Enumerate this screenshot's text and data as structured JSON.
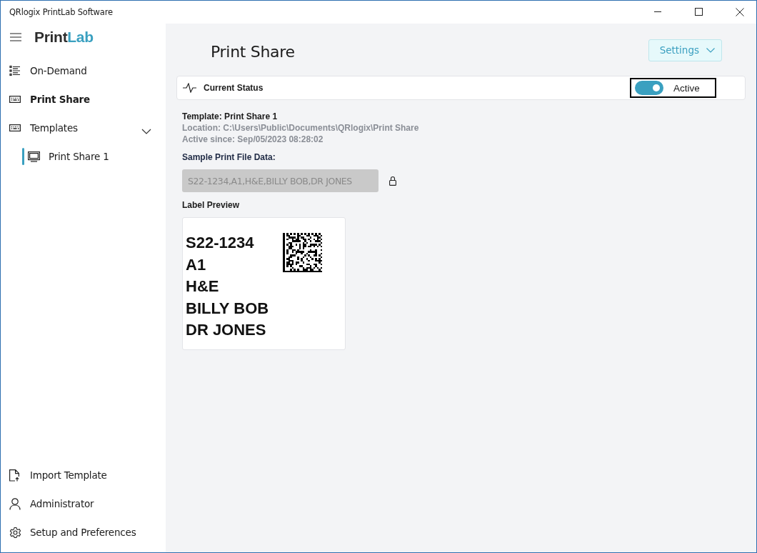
{
  "window": {
    "title": "QRlogix PrintLab Software"
  },
  "logo": [
    "Print",
    "Lab"
  ],
  "sidebar": {
    "items": [
      {
        "label": "On-Demand",
        "kind": "list",
        "selected": false
      },
      {
        "label": "Print Share",
        "kind": "keyboard",
        "selected": true
      },
      {
        "label": "Templates",
        "kind": "keyboard",
        "selected": false,
        "expanded": true,
        "children": [
          {
            "label": "Print Share 1",
            "kind": "monitor",
            "selected": true
          }
        ]
      }
    ],
    "footer_items": [
      {
        "label": "Import Template",
        "kind": "import"
      },
      {
        "label": "Administrator",
        "kind": "person"
      },
      {
        "label": "Setup and Preferences",
        "kind": "gear"
      }
    ]
  },
  "page": {
    "title": "Print Share",
    "settings_button": "Settings"
  },
  "status": {
    "title": "Current Status",
    "toggle": {
      "label": "Active",
      "on": true
    }
  },
  "details": {
    "template": "Template: Print Share 1",
    "location": "Location: C:\\Users\\Public\\Documents\\QRlogix\\Print Share",
    "active_since": "Active since: Sep/05/2023 08:28:02"
  },
  "sample": {
    "label": "Sample Print File Data:",
    "value": "S22-1234,A1,H&E,BILLY BOB,DR JONES",
    "disabled": true
  },
  "preview": {
    "label": "Label Preview",
    "lines": [
      "S22-1234",
      "A1",
      "H&E",
      "BILLY BOB",
      "DR JONES"
    ]
  }
}
